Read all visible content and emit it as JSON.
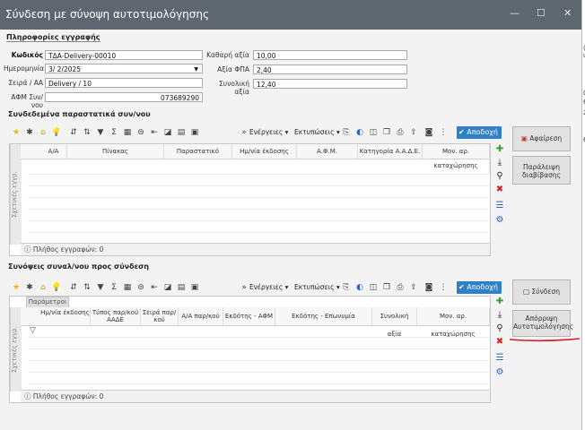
{
  "window": {
    "title": "Σύνδεση με σύνοψη αυτοτιμολόγησης",
    "controls": {
      "minimize": "—",
      "maximize": "☐",
      "close": "✕"
    }
  },
  "registration": {
    "section_title": "Πληροφορίες εγγραφής",
    "code_label": "Κωδικός",
    "code_value": "ΤΔΑ-Delivery-00010",
    "date_label": "Ημερομηνία",
    "date_value": "3/ 2/2025",
    "series_label": "Σειρά / ΑΑ",
    "series_value": "Delivery / 10",
    "afm_label": "ΑΦΜ Συν/νου",
    "afm_value": "073689290",
    "net_label": "Καθαρή αξία",
    "net_value": "10,00",
    "vat_label": "Αξία ΦΠΑ",
    "vat_value": "2,40",
    "total_label": "Συνολική αξία",
    "total_value": "12,40"
  },
  "linked": {
    "section_title": "Συνδεδεμένα παραστατικά συν/νου",
    "actions_label": "Ενέργειες",
    "print_label": "Εκτυπώσεις",
    "accept_label": "Αποδοχή",
    "vertical_tab": "Σχετικές εγγρ.",
    "columns": [
      "Α/Α",
      "Πίνακας",
      "Παραστατικό",
      "Ημ/νία έκδοσης",
      "Α.Φ.Μ.",
      "Κατηγορία Α.Α.Δ.Ε.",
      "Μον. αρ. καταχώρησης"
    ],
    "footer": "Πλήθος εγγραφών: 0",
    "remove_button": "Αφαίρεση",
    "skip_button": "Παράλειψη διαβίβασης"
  },
  "summaries": {
    "section_title": "Συνόψεις συναλ/νου προς σύνδεση",
    "params_tab": "Παράμετροι",
    "actions_label": "Ενέργειες",
    "print_label": "Εκτυπώσεις",
    "accept_label": "Αποδοχή",
    "vertical_tab": "Σχετικές εγγρ.",
    "columns": [
      "Ημ/νία έκδοσης",
      "Τύπος παρ/κού ΑΑΔΕ",
      "Σειρά παρ/κού",
      "Α/Α παρ/κού",
      "Εκδότης - ΑΦΜ",
      "Εκδότης - Επωνυμία",
      "Συνολική αξία",
      "Μον. αρ. καταχώρησης"
    ],
    "footer": "Πλήθος εγγραφών: 0",
    "link_button": "Σύνδεση",
    "reject_button": "Απόρριψη Αυτοτιμολόγησης"
  },
  "right_strip_text": [
    "(",
    "ιρ",
    "0",
    "6",
    "2",
    "6"
  ],
  "colors": {
    "titlebar": "#5e6670",
    "accept": "#2f7fc9",
    "annotation": "#d62020",
    "remove": "#d32f2f"
  }
}
